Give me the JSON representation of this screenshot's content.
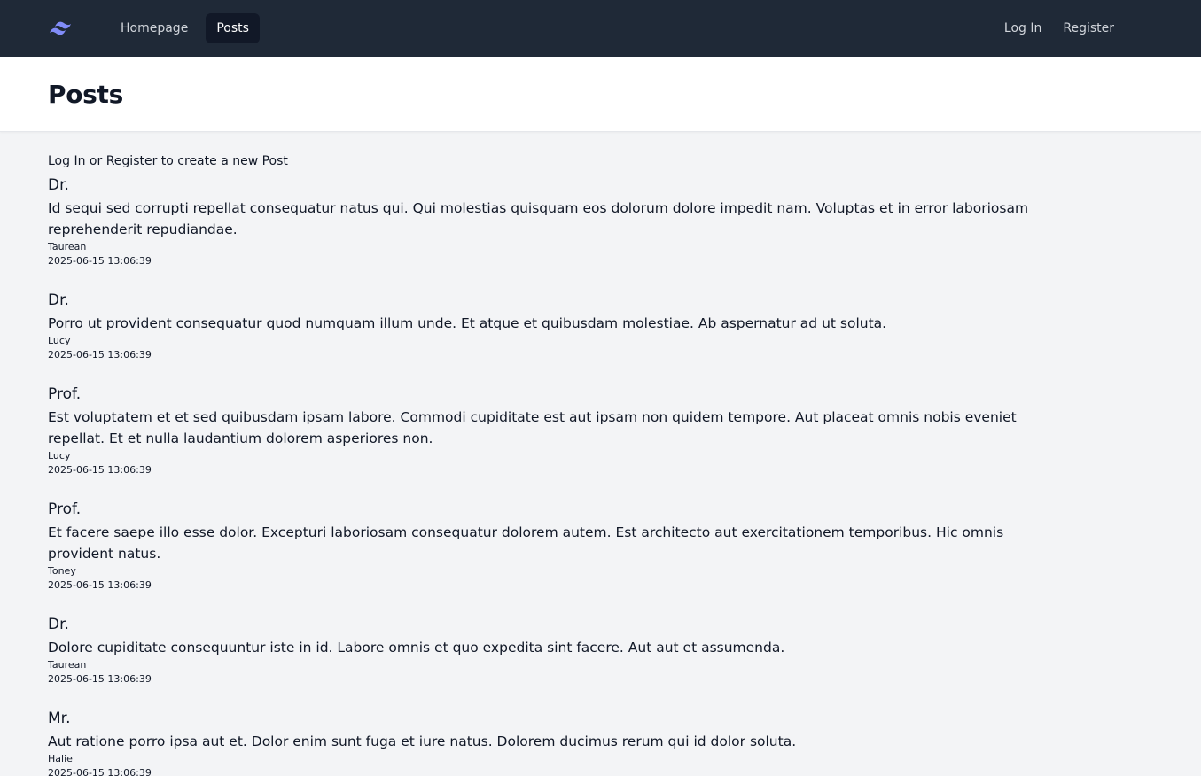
{
  "nav": {
    "links": [
      {
        "label": "Homepage"
      },
      {
        "label": "Posts"
      }
    ],
    "auth": {
      "login_label": "Log In",
      "register_label": "Register"
    },
    "accent_color": "#818cf8"
  },
  "header": {
    "title": "Posts"
  },
  "main": {
    "cta": {
      "login": "Log In",
      "or": "or",
      "register": "Register",
      "suffix": "to create a new Post"
    },
    "posts": [
      {
        "title": "Dr.",
        "body": "Id sequi sed corrupti repellat consequatur natus qui. Qui molestias quisquam eos dolorum dolore impedit nam. Voluptas et in error laboriosam reprehenderit repudiandae.",
        "author": "Taurean",
        "date": "2025-06-15 13:06:39"
      },
      {
        "title": "Dr.",
        "body": "Porro ut provident consequatur quod numquam illum unde. Et atque et quibusdam molestiae. Ab aspernatur ad ut soluta.",
        "author": "Lucy",
        "date": "2025-06-15 13:06:39"
      },
      {
        "title": "Prof.",
        "body": "Est voluptatem et et sed quibusdam ipsam labore. Commodi cupiditate est aut ipsam non quidem tempore. Aut placeat omnis nobis eveniet repellat. Et et nulla laudantium dolorem asperiores non.",
        "author": "Lucy",
        "date": "2025-06-15 13:06:39"
      },
      {
        "title": "Prof.",
        "body": "Et facere saepe illo esse dolor. Excepturi laboriosam consequatur dolorem autem. Est architecto aut exercitationem temporibus. Hic omnis provident natus.",
        "author": "Toney",
        "date": "2025-06-15 13:06:39"
      },
      {
        "title": "Dr.",
        "body": "Dolore cupiditate consequuntur iste in id. Labore omnis et quo expedita sint facere. Aut aut et assumenda.",
        "author": "Taurean",
        "date": "2025-06-15 13:06:39"
      },
      {
        "title": "Mr.",
        "body": "Aut ratione porro ipsa aut et. Dolor enim sunt fuga et iure natus. Dolorem ducimus rerum qui id dolor soluta.",
        "author": "Halie",
        "date": "2025-06-15 13:06:39"
      }
    ]
  }
}
